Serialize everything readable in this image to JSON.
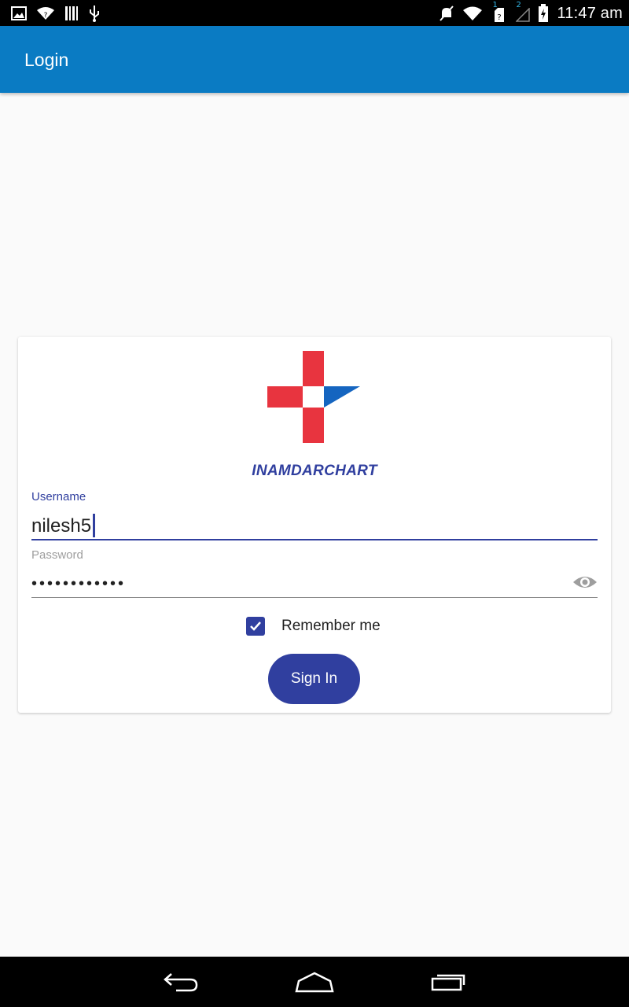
{
  "status_bar": {
    "time": "11:47 am",
    "sim1": "1",
    "sim2": "2",
    "icons_left": [
      "gallery-icon",
      "wifi-icon",
      "barcode-icon",
      "usb-icon"
    ],
    "icons_right": [
      "mute-icon",
      "wifi-icon",
      "sim1-icon",
      "sim2-icon",
      "battery-icon"
    ]
  },
  "app_bar": {
    "title": "Login"
  },
  "login": {
    "brand": "INAMDARCHART",
    "username_label": "Username",
    "username_value": "nilesh5",
    "password_label": "Password",
    "password_value": "••••••••••••",
    "remember_label": "Remember me",
    "remember_checked": true,
    "signin_label": "Sign In"
  },
  "colors": {
    "app_bar": "#0a7bc3",
    "primary": "#303f9f",
    "logo_red": "#e8343f",
    "logo_blue": "#1565c0"
  },
  "nav_bar": {
    "icons": [
      "back-icon",
      "home-icon",
      "recents-icon"
    ]
  }
}
